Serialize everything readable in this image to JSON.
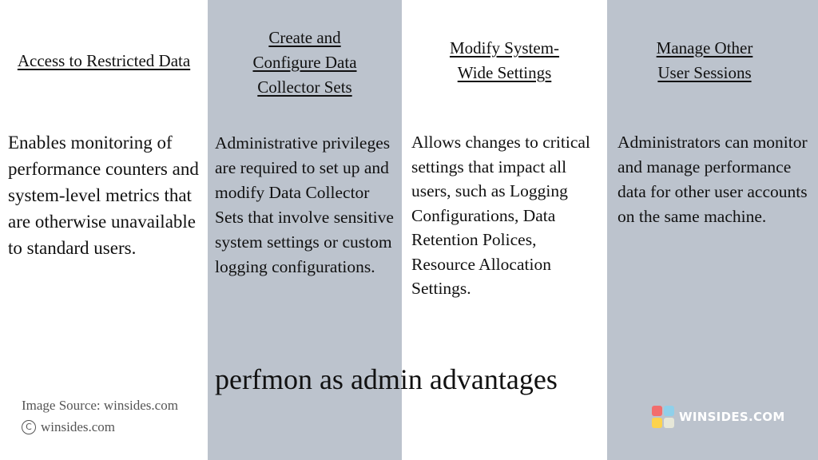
{
  "columns": [
    {
      "heading": "Access to Restricted Data",
      "body": "Enables monitoring of performance counters and system-level metrics that are otherwise unavailable to standard users."
    },
    {
      "heading": "Create and \nConfigure Data\n Collector Sets",
      "body": "Administrative privileges are required to set up and modify Data Collector Sets that involve sensitive system settings or custom logging configurations."
    },
    {
      "heading": "Modify System-\nWide Settings",
      "body": "Allows changes to critical settings that impact all users, such as Logging Configurations, Data Retention Polices, Resource Allocation Settings."
    },
    {
      "heading": "Manage Other\nUser Sessions",
      "body": "Administrators can monitor and manage performance data for other user accounts on the same machine."
    }
  ],
  "title": "perfmon as admin advantages",
  "footer": {
    "image_source": "Image Source: winsides.com",
    "copyright_icon": "copyright-icon",
    "copyright_glyph": "C",
    "copyright_text": "winsides.com"
  },
  "logo": {
    "text": "WINSIDES.COM",
    "icon": "four-tile-logo-icon",
    "tile_colors": [
      "#f26d6d",
      "#8fd0ea",
      "#fcd34d",
      "#e6e7d8"
    ]
  },
  "colors": {
    "panel_white": "#ffffff",
    "panel_grey": "#bcc3cd",
    "text": "#111111",
    "muted_text": "#555555"
  }
}
